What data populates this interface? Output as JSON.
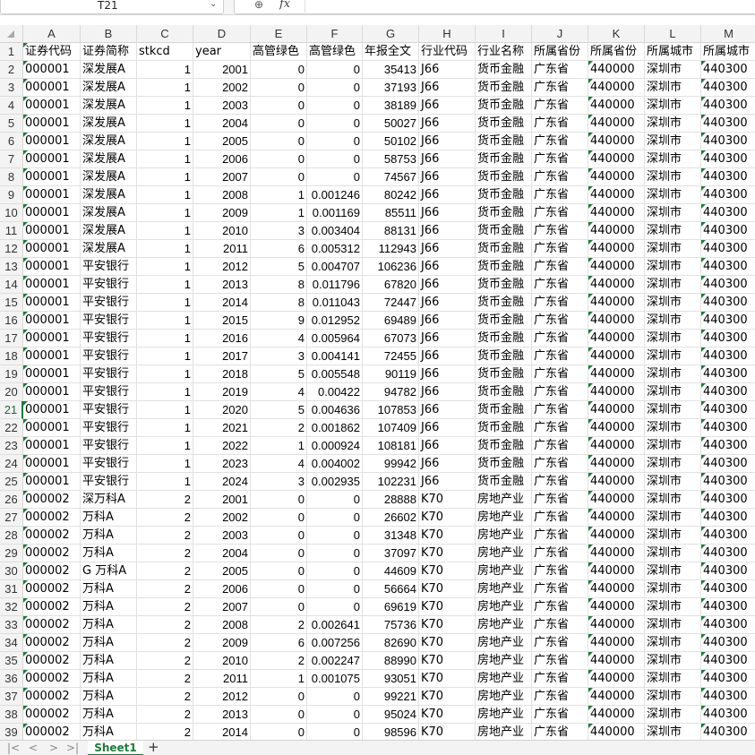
{
  "formula_bar": {
    "name_box": "T21",
    "zoom_icon": "search-icon",
    "fx_label": "fx"
  },
  "columns": [
    {
      "letter": "A",
      "header": "证券代码",
      "type": "txt",
      "tri": true
    },
    {
      "letter": "B",
      "header": "证券简称",
      "type": "txt",
      "tri": false
    },
    {
      "letter": "C",
      "header": "stkcd",
      "type": "num",
      "tri": false
    },
    {
      "letter": "D",
      "header": "year",
      "type": "num",
      "tri": false
    },
    {
      "letter": "E",
      "header": "高管绿色",
      "type": "num",
      "tri": false
    },
    {
      "letter": "F",
      "header": "高管绿色",
      "type": "num",
      "tri": false
    },
    {
      "letter": "G",
      "header": "年报全文",
      "type": "num",
      "tri": false
    },
    {
      "letter": "H",
      "header": "行业代码",
      "type": "txt",
      "tri": false
    },
    {
      "letter": "I",
      "header": "行业名称",
      "type": "txt",
      "tri": false
    },
    {
      "letter": "J",
      "header": "所属省份",
      "type": "txt",
      "tri": false
    },
    {
      "letter": "K",
      "header": "所属省份",
      "type": "txt",
      "tri": true
    },
    {
      "letter": "L",
      "header": "所属城市",
      "type": "txt",
      "tri": false
    },
    {
      "letter": "M",
      "header": "所属城市",
      "type": "txt",
      "tri": true
    }
  ],
  "rows": [
    [
      "000001",
      "深发展A",
      "1",
      "2001",
      "0",
      "0",
      "35413",
      "J66",
      "货币金融",
      "广东省",
      "440000",
      "深圳市",
      "440300"
    ],
    [
      "000001",
      "深发展A",
      "1",
      "2002",
      "0",
      "0",
      "37193",
      "J66",
      "货币金融",
      "广东省",
      "440000",
      "深圳市",
      "440300"
    ],
    [
      "000001",
      "深发展A",
      "1",
      "2003",
      "0",
      "0",
      "38189",
      "J66",
      "货币金融",
      "广东省",
      "440000",
      "深圳市",
      "440300"
    ],
    [
      "000001",
      "深发展A",
      "1",
      "2004",
      "0",
      "0",
      "50027",
      "J66",
      "货币金融",
      "广东省",
      "440000",
      "深圳市",
      "440300"
    ],
    [
      "000001",
      "深发展A",
      "1",
      "2005",
      "0",
      "0",
      "50102",
      "J66",
      "货币金融",
      "广东省",
      "440000",
      "深圳市",
      "440300"
    ],
    [
      "000001",
      "深发展A",
      "1",
      "2006",
      "0",
      "0",
      "58753",
      "J66",
      "货币金融",
      "广东省",
      "440000",
      "深圳市",
      "440300"
    ],
    [
      "000001",
      "深发展A",
      "1",
      "2007",
      "0",
      "0",
      "74567",
      "J66",
      "货币金融",
      "广东省",
      "440000",
      "深圳市",
      "440300"
    ],
    [
      "000001",
      "深发展A",
      "1",
      "2008",
      "1",
      "0.001246",
      "80242",
      "J66",
      "货币金融",
      "广东省",
      "440000",
      "深圳市",
      "440300"
    ],
    [
      "000001",
      "深发展A",
      "1",
      "2009",
      "1",
      "0.001169",
      "85511",
      "J66",
      "货币金融",
      "广东省",
      "440000",
      "深圳市",
      "440300"
    ],
    [
      "000001",
      "深发展A",
      "1",
      "2010",
      "3",
      "0.003404",
      "88131",
      "J66",
      "货币金融",
      "广东省",
      "440000",
      "深圳市",
      "440300"
    ],
    [
      "000001",
      "深发展A",
      "1",
      "2011",
      "6",
      "0.005312",
      "112943",
      "J66",
      "货币金融",
      "广东省",
      "440000",
      "深圳市",
      "440300"
    ],
    [
      "000001",
      "平安银行",
      "1",
      "2012",
      "5",
      "0.004707",
      "106236",
      "J66",
      "货币金融",
      "广东省",
      "440000",
      "深圳市",
      "440300"
    ],
    [
      "000001",
      "平安银行",
      "1",
      "2013",
      "8",
      "0.011796",
      "67820",
      "J66",
      "货币金融",
      "广东省",
      "440000",
      "深圳市",
      "440300"
    ],
    [
      "000001",
      "平安银行",
      "1",
      "2014",
      "8",
      "0.011043",
      "72447",
      "J66",
      "货币金融",
      "广东省",
      "440000",
      "深圳市",
      "440300"
    ],
    [
      "000001",
      "平安银行",
      "1",
      "2015",
      "9",
      "0.012952",
      "69489",
      "J66",
      "货币金融",
      "广东省",
      "440000",
      "深圳市",
      "440300"
    ],
    [
      "000001",
      "平安银行",
      "1",
      "2016",
      "4",
      "0.005964",
      "67073",
      "J66",
      "货币金融",
      "广东省",
      "440000",
      "深圳市",
      "440300"
    ],
    [
      "000001",
      "平安银行",
      "1",
      "2017",
      "3",
      "0.004141",
      "72455",
      "J66",
      "货币金融",
      "广东省",
      "440000",
      "深圳市",
      "440300"
    ],
    [
      "000001",
      "平安银行",
      "1",
      "2018",
      "5",
      "0.005548",
      "90119",
      "J66",
      "货币金融",
      "广东省",
      "440000",
      "深圳市",
      "440300"
    ],
    [
      "000001",
      "平安银行",
      "1",
      "2019",
      "4",
      "0.00422",
      "94782",
      "J66",
      "货币金融",
      "广东省",
      "440000",
      "深圳市",
      "440300"
    ],
    [
      "000001",
      "平安银行",
      "1",
      "2020",
      "5",
      "0.004636",
      "107853",
      "J66",
      "货币金融",
      "广东省",
      "440000",
      "深圳市",
      "440300"
    ],
    [
      "000001",
      "平安银行",
      "1",
      "2021",
      "2",
      "0.001862",
      "107409",
      "J66",
      "货币金融",
      "广东省",
      "440000",
      "深圳市",
      "440300"
    ],
    [
      "000001",
      "平安银行",
      "1",
      "2022",
      "1",
      "0.000924",
      "108181",
      "J66",
      "货币金融",
      "广东省",
      "440000",
      "深圳市",
      "440300"
    ],
    [
      "000001",
      "平安银行",
      "1",
      "2023",
      "4",
      "0.004002",
      "99942",
      "J66",
      "货币金融",
      "广东省",
      "440000",
      "深圳市",
      "440300"
    ],
    [
      "000001",
      "平安银行",
      "1",
      "2024",
      "3",
      "0.002935",
      "102231",
      "J66",
      "货币金融",
      "广东省",
      "440000",
      "深圳市",
      "440300"
    ],
    [
      "000002",
      "深万科A",
      "2",
      "2001",
      "0",
      "0",
      "28888",
      "K70",
      "房地产业",
      "广东省",
      "440000",
      "深圳市",
      "440300"
    ],
    [
      "000002",
      "万科A",
      "2",
      "2002",
      "0",
      "0",
      "26602",
      "K70",
      "房地产业",
      "广东省",
      "440000",
      "深圳市",
      "440300"
    ],
    [
      "000002",
      "万科A",
      "2",
      "2003",
      "0",
      "0",
      "31348",
      "K70",
      "房地产业",
      "广东省",
      "440000",
      "深圳市",
      "440300"
    ],
    [
      "000002",
      "万科A",
      "2",
      "2004",
      "0",
      "0",
      "37097",
      "K70",
      "房地产业",
      "广东省",
      "440000",
      "深圳市",
      "440300"
    ],
    [
      "000002",
      "G 万科A",
      "2",
      "2005",
      "0",
      "0",
      "44609",
      "K70",
      "房地产业",
      "广东省",
      "440000",
      "深圳市",
      "440300"
    ],
    [
      "000002",
      "万科A",
      "2",
      "2006",
      "0",
      "0",
      "56664",
      "K70",
      "房地产业",
      "广东省",
      "440000",
      "深圳市",
      "440300"
    ],
    [
      "000002",
      "万科A",
      "2",
      "2007",
      "0",
      "0",
      "69619",
      "K70",
      "房地产业",
      "广东省",
      "440000",
      "深圳市",
      "440300"
    ],
    [
      "000002",
      "万科A",
      "2",
      "2008",
      "2",
      "0.002641",
      "75736",
      "K70",
      "房地产业",
      "广东省",
      "440000",
      "深圳市",
      "440300"
    ],
    [
      "000002",
      "万科A",
      "2",
      "2009",
      "6",
      "0.007256",
      "82690",
      "K70",
      "房地产业",
      "广东省",
      "440000",
      "深圳市",
      "440300"
    ],
    [
      "000002",
      "万科A",
      "2",
      "2010",
      "2",
      "0.002247",
      "88990",
      "K70",
      "房地产业",
      "广东省",
      "440000",
      "深圳市",
      "440300"
    ],
    [
      "000002",
      "万科A",
      "2",
      "2011",
      "1",
      "0.001075",
      "93051",
      "K70",
      "房地产业",
      "广东省",
      "440000",
      "深圳市",
      "440300"
    ],
    [
      "000002",
      "万科A",
      "2",
      "2012",
      "0",
      "0",
      "99221",
      "K70",
      "房地产业",
      "广东省",
      "440000",
      "深圳市",
      "440300"
    ],
    [
      "000002",
      "万科A",
      "2",
      "2013",
      "0",
      "0",
      "95024",
      "K70",
      "房地产业",
      "广东省",
      "440000",
      "深圳市",
      "440300"
    ],
    [
      "000002",
      "万科A",
      "2",
      "2014",
      "0",
      "0",
      "98596",
      "K70",
      "房地产业",
      "广东省",
      "440000",
      "深圳市",
      "440300"
    ]
  ],
  "selected_row": 21,
  "tabbar": {
    "nav_first": "|<",
    "nav_prev": "<",
    "nav_next": ">",
    "nav_last": ">|",
    "sheet_name": "Sheet1",
    "add_label": "+"
  },
  "colors": {
    "accent": "#1e7a3a",
    "header_bg": "#f3f3f3",
    "grid_line": "#e1e1e1"
  }
}
